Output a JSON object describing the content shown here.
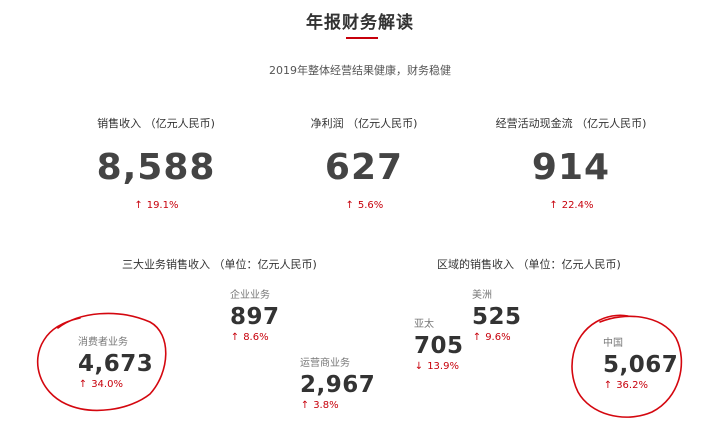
{
  "header": {
    "title": "年报财务解读",
    "subtitle": "2019年整体经营结果健康，财务稳健"
  },
  "kpis": [
    {
      "label": "销售收入 （亿元人民币)",
      "value": "8,588",
      "change": "19.1%",
      "direction": "up"
    },
    {
      "label": "净利润 （亿元人民币)",
      "value": "627",
      "change": "5.6%",
      "direction": "up"
    },
    {
      "label": "经营活动现金流 （亿元人民币)",
      "value": "914",
      "change": "22.4%",
      "direction": "up"
    }
  ],
  "business": {
    "title": "三大业务销售收入 （单位：亿元人民币)",
    "consumer": {
      "label": "消费者业务",
      "value": "4,673",
      "change": "34.0%",
      "direction": "up"
    },
    "enterprise": {
      "label": "企业业务",
      "value": "897",
      "change": "8.6%",
      "direction": "up"
    },
    "carrier": {
      "label": "运营商业务",
      "value": "2,967",
      "change": "3.8%",
      "direction": "up"
    }
  },
  "region": {
    "title": "区域的销售收入 （单位：亿元人民币)",
    "asia": {
      "label": "亚太",
      "value": "705",
      "change": "13.9%",
      "direction": "down"
    },
    "americas": {
      "label": "美洲",
      "value": "525",
      "change": "9.6%",
      "direction": "up"
    },
    "china": {
      "label": "中国",
      "value": "5,067",
      "change": "36.2%",
      "direction": "up"
    }
  },
  "glyphs": {
    "up": "↑",
    "down": "↓"
  },
  "colors": {
    "accent": "#c7000b",
    "text": "#333333",
    "muted": "#777777"
  }
}
